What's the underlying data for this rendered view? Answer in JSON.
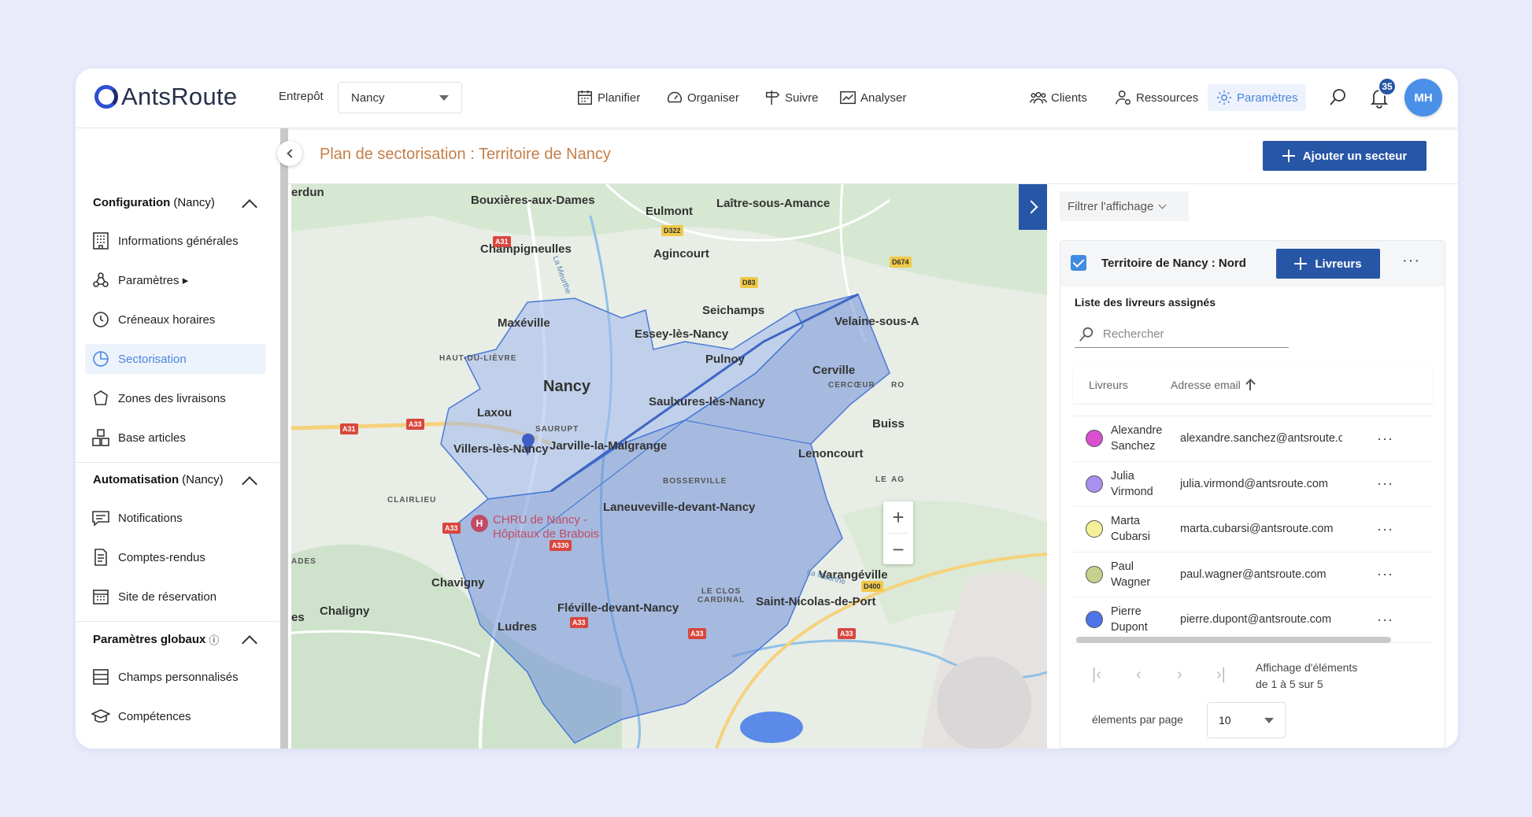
{
  "header": {
    "logo": "AntsRoute",
    "warehouse_label": "Entrepôt",
    "warehouse_value": "Nancy",
    "nav": [
      {
        "label": "Planifier",
        "icon": "calendar-icon"
      },
      {
        "label": "Organiser",
        "icon": "gauge-icon"
      },
      {
        "label": "Suivre",
        "icon": "signpost-icon"
      },
      {
        "label": "Analyser",
        "icon": "chart-icon"
      }
    ],
    "nav_right": [
      {
        "label": "Clients",
        "icon": "users-icon"
      },
      {
        "label": "Ressources",
        "icon": "user-gear-icon"
      },
      {
        "label": "Paramètres",
        "icon": "gear-icon",
        "active": true
      }
    ],
    "notification_count": "35",
    "avatar_initials": "MH",
    "accent": "#4a86dd"
  },
  "sidebar": {
    "sections": [
      {
        "title": "Configuration",
        "suffix": "(Nancy)"
      },
      {
        "title": "Automatisation",
        "suffix": "(Nancy)"
      },
      {
        "title": "Paramètres globaux",
        "suffix": "ⓘ"
      }
    ],
    "items": [
      {
        "label": "Informations générales",
        "icon": "building-icon"
      },
      {
        "label": "Paramètres ▸",
        "icon": "nodes-icon"
      },
      {
        "label": "Créneaux horaires",
        "icon": "clock-icon"
      },
      {
        "label": "Sectorisation",
        "icon": "pie-icon",
        "active": true
      },
      {
        "label": "Zones des livraisons",
        "icon": "polygon-icon"
      },
      {
        "label": "Base articles",
        "icon": "boxes-icon"
      },
      {
        "label": "Notifications",
        "icon": "message-icon"
      },
      {
        "label": "Comptes-rendus",
        "icon": "document-icon"
      },
      {
        "label": "Site de réservation",
        "icon": "calendar-grid-icon"
      },
      {
        "label": "Champs personnalisés",
        "icon": "form-icon"
      },
      {
        "label": "Compétences",
        "icon": "graduation-icon"
      }
    ]
  },
  "page": {
    "title": "Plan de sectorisation : Territoire de Nancy",
    "add_sector_label": "Ajouter un secteur",
    "title_color": "#c47f49",
    "primary_color": "#2856a6"
  },
  "map": {
    "labels": [
      "erdun",
      "Bouxières-aux-Dames",
      "Eulmont",
      "Laître-sous-Amance",
      "Champigneulles",
      "Agincourt",
      "Maxéville",
      "Seichamps",
      "Essey-lès-Nancy",
      "Velaine-sous-A",
      "Pulnoy",
      "Cerville",
      "Nancy",
      "Laxou",
      "Saulxures-lès-Nancy",
      "Buiss",
      "Villers-lès-Nancy",
      "Jarville-la-Malgrange",
      "Lenoncourt",
      "Laneuveville-devant-Nancy",
      "Chavigny",
      "Varangéville",
      "Chaligny",
      "Fléville-devant-Nancy",
      "Saint-Nicolas-de-Port",
      "Ludres",
      "es"
    ],
    "small_labels": [
      "HAUT-DU-LIÈVRE",
      "SAURUPT",
      "BOSSERVILLE",
      "CLAIRLIEU",
      "CERCŒUR",
      "LE CLOS CARDINAL",
      "ADES",
      "RO",
      "LE",
      "AG"
    ],
    "poi": [
      "CHRU de Nancy -",
      "Hôpitaux de Brabois"
    ],
    "roads": [
      "A31",
      "D322",
      "D83",
      "D674",
      "A31",
      "A33",
      "A33",
      "A330",
      "A33",
      "A33",
      "A33",
      "D400"
    ],
    "river": [
      "La Meurthe",
      "La Meurthe"
    ],
    "zoom_in": "+",
    "zoom_out": "−"
  },
  "panel": {
    "filter_label": "Filtrer l'affichage",
    "sector_name": "Territoire de Nancy : Nord",
    "livreurs_button": "Livreurs",
    "list_title": "Liste des livreurs assignés",
    "search_placeholder": "Rechercher",
    "columns": [
      "Livreurs",
      "Adresse email"
    ],
    "rows": [
      {
        "first": "Alexandre",
        "last": "Sanchez",
        "email": "alexandre.sanchez@antsroute.com",
        "color": "#d94fcf"
      },
      {
        "first": "Julia",
        "last": "Virmond",
        "email": "julia.virmond@antsroute.com",
        "color": "#a98ff0"
      },
      {
        "first": "Marta",
        "last": "Cubarsi",
        "email": "marta.cubarsi@antsroute.com",
        "color": "#f6ef9a"
      },
      {
        "first": "Paul",
        "last": "Wagner",
        "email": "paul.wagner@antsroute.com",
        "color": "#c4d28c"
      },
      {
        "first": "Pierre",
        "last": "Dupont",
        "email": "pierre.dupont@antsroute.com",
        "color": "#4d74e8"
      }
    ],
    "pagination_info_1": "Affichage d'éléments",
    "pagination_info_2": "de 1 à 5 sur 5",
    "per_page_label": "élements par page",
    "per_page_value": "10"
  }
}
